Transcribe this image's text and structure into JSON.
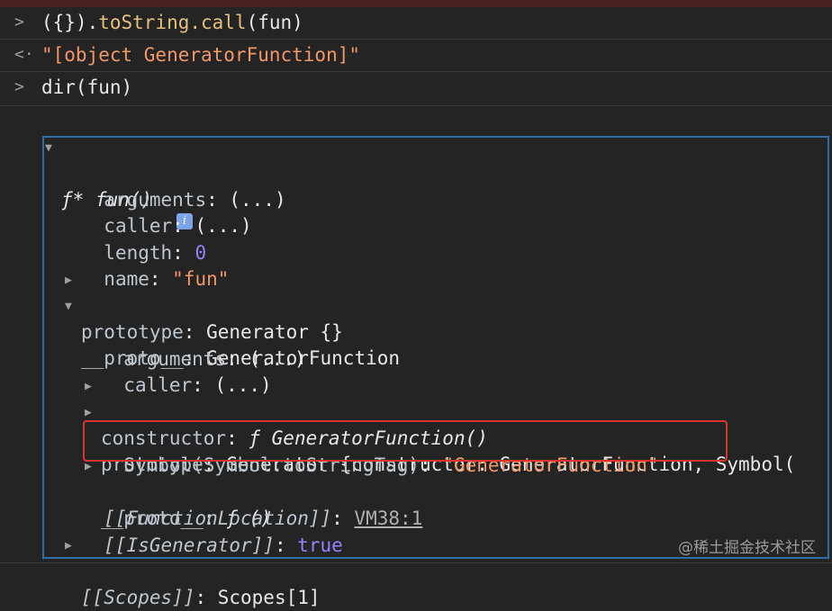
{
  "console": {
    "line1": {
      "prompt": ">",
      "pre": "({}).",
      "method": "toString.call",
      "post": "(fun)"
    },
    "line2": {
      "prompt": "<·",
      "value": "\"[object GeneratorFunction]\""
    },
    "line3": {
      "prompt": ">",
      "text": "dir(fun)"
    }
  },
  "tree": {
    "root_label": "ƒ* fun()",
    "info_badge": "i",
    "rows": [
      {
        "key": "arguments",
        "sep": ": ",
        "value": "(...)"
      },
      {
        "key": "caller",
        "sep": ": ",
        "value": "(...)"
      },
      {
        "key": "length",
        "sep": ": ",
        "value": "0"
      },
      {
        "key": "name",
        "sep": ": ",
        "value": "\"fun\""
      },
      {
        "key": "prototype",
        "sep": ": ",
        "value": "Generator {}"
      },
      {
        "key": "__proto__",
        "sep": ": ",
        "value": "GeneratorFunction"
      },
      {
        "key": "arguments",
        "sep": ": ",
        "value": "(...)"
      },
      {
        "key": "caller",
        "sep": ": ",
        "value": "(...)"
      },
      {
        "key": "constructor",
        "sep": ": ",
        "value": "ƒ GeneratorFunction()"
      },
      {
        "key": "prototype",
        "sep": ": ",
        "value": "Generator {constructor: GeneratorFunction, Symbol("
      },
      {
        "key": "Symbol(Symbol.toStringTag)",
        "sep": ": ",
        "value": "\"GeneratorFunction\""
      },
      {
        "key": "__proto__",
        "sep": ": ",
        "value": "ƒ ()"
      },
      {
        "key": "[[FunctionLocation]]",
        "sep": ": ",
        "value": "VM38:1"
      },
      {
        "key": "[[IsGenerator]]",
        "sep": ": ",
        "value": "true"
      },
      {
        "key": "[[Scopes]]",
        "sep": ": ",
        "value": "Scopes[1]"
      }
    ]
  },
  "watermark": "@稀土掘金技术社区",
  "colors": {
    "highlight_box": "#2f6ea8",
    "red_box": "#d6362e",
    "string": "#f29766",
    "number": "#9980ff"
  }
}
